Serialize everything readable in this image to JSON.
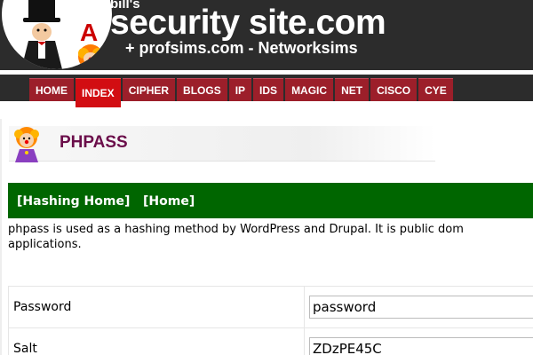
{
  "header": {
    "site_prefix": "bill's",
    "site_title": "security site.com",
    "tagline": "+ profsims.com - Networksims",
    "logo_letter": "A"
  },
  "nav": {
    "items": [
      "HOME",
      "INDEX",
      "CIPHER",
      "BLOGS",
      "IP",
      "IDS",
      "MAGIC",
      "NET",
      "CISCO",
      "CYE"
    ],
    "active": "INDEX"
  },
  "page": {
    "title": "PHPASS",
    "links": {
      "hashing_home": "[Hashing Home]",
      "home": "[Home]"
    },
    "intro_line1": "phpass is used as a hashing method by WordPress and Drupal. It is public dom",
    "intro_line2": "applications."
  },
  "form": {
    "password_label": "Password",
    "password_value": "password",
    "salt_label": "Salt",
    "salt_value": "ZDzPE45C"
  },
  "colors": {
    "header_bg": "#2c2c2c",
    "nav_bg": "#9c1f2a",
    "nav_active_bg": "#d20d12",
    "title_color": "#6b0e4a",
    "green_bar": "#006600"
  }
}
